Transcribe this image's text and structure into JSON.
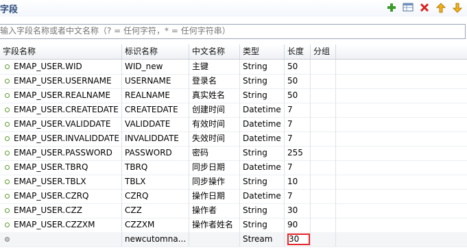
{
  "panel": {
    "title": "字段"
  },
  "toolbar": {
    "icons": [
      "add-icon",
      "table-icon",
      "delete-icon",
      "move-up-icon",
      "move-down-icon"
    ]
  },
  "filter": {
    "placeholder": "输入字段名称或者中文名称（? = 任何字符，* = 任何字符串）",
    "value": ""
  },
  "table": {
    "columns": [
      "字段名称",
      "标识名称",
      "中文名称",
      "类型",
      "长度",
      "分组"
    ],
    "rows": [
      [
        "EMAP_USER.WID",
        "WID_new",
        "主键",
        "String",
        "50",
        ""
      ],
      [
        "EMAP_USER.USERNAME",
        "USERNAME",
        "登录名",
        "String",
        "50",
        ""
      ],
      [
        "EMAP_USER.REALNAME",
        "REALNAME",
        "真实姓名",
        "String",
        "50",
        ""
      ],
      [
        "EMAP_USER.CREATEDATE",
        "CREATEDATE",
        "创建时间",
        "Datetime",
        "7",
        ""
      ],
      [
        "EMAP_USER.VALIDDATE",
        "VALIDDATE",
        "有效时间",
        "Datetime",
        "7",
        ""
      ],
      [
        "EMAP_USER.INVALIDDATE",
        "INVALIDDATE",
        "失效时间",
        "Datetime",
        "7",
        ""
      ],
      [
        "EMAP_USER.PASSWORD",
        "PASSWORD",
        "密码",
        "String",
        "255",
        ""
      ],
      [
        "EMAP_USER.TBRQ",
        "TBRQ",
        "同步日期",
        "Datetime",
        "7",
        ""
      ],
      [
        "EMAP_USER.TBLX",
        "TBLX",
        "同步操作",
        "String",
        "10",
        ""
      ],
      [
        "EMAP_USER.CZRQ",
        "CZRQ",
        "操作日期",
        "Datetime",
        "7",
        ""
      ],
      [
        "EMAP_USER.CZZ",
        "CZZ",
        "操作者",
        "String",
        "30",
        ""
      ],
      [
        "EMAP_USER.CZZXM",
        "CZZXM",
        "操作者姓名",
        "String",
        "90",
        ""
      ],
      [
        "",
        "newcutomna...",
        "",
        "Stream",
        "30",
        ""
      ]
    ]
  }
}
